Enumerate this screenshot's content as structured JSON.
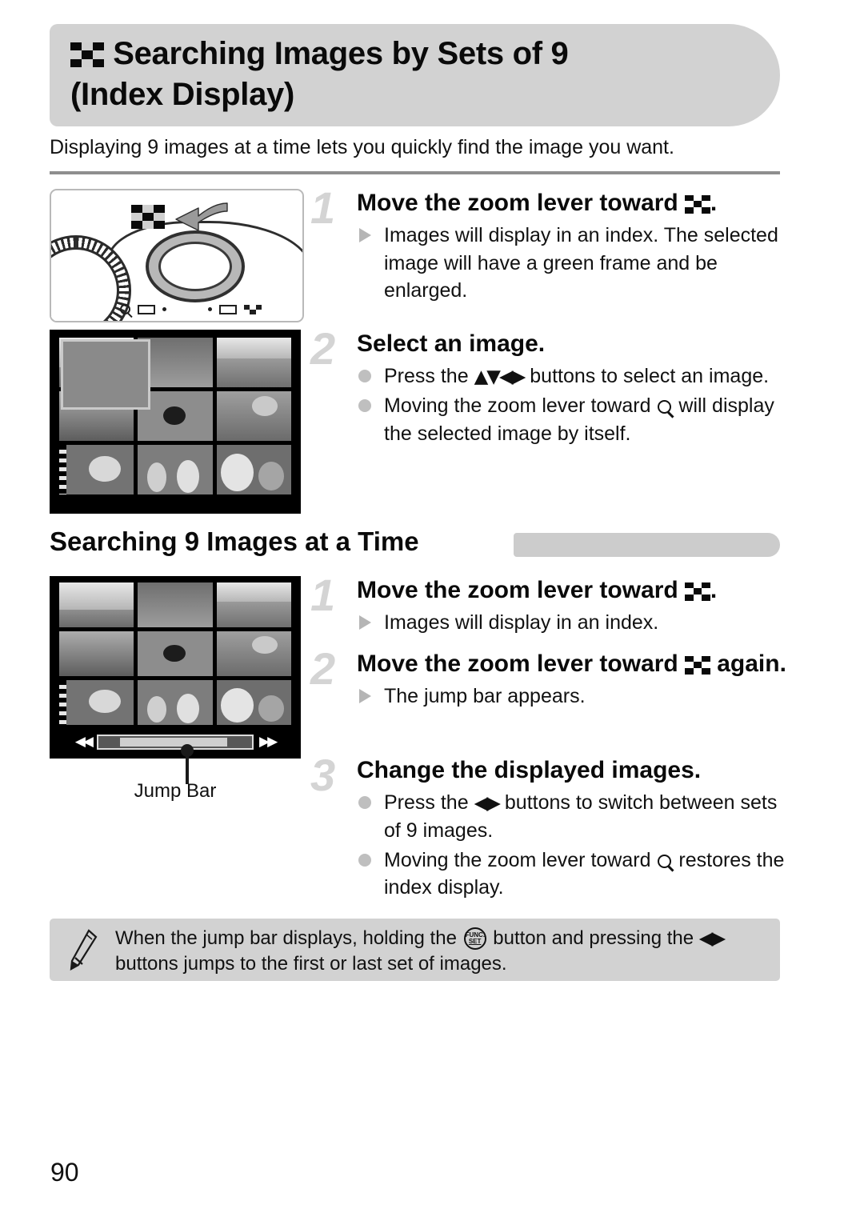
{
  "header": {
    "icon": "checkerboard-index-icon",
    "title_line1": "Searching Images by Sets of 9",
    "title_line2": "(Index Display)"
  },
  "intro": "Displaying 9 images at a time lets you quickly find the image you want.",
  "section1": {
    "steps": [
      {
        "number": "1",
        "title_before": "Move the zoom lever toward",
        "title_after": ".",
        "bullets": [
          {
            "marker": "triangle",
            "text": "Images will display in an index. The selected image will have a green frame and be enlarged."
          }
        ]
      },
      {
        "number": "2",
        "title_before": "Select an image.",
        "title_after": "",
        "bullets": [
          {
            "marker": "dot",
            "text_before": "Press the",
            "glyphs": "▲▼◀▶",
            "text_after": "buttons to select an image."
          },
          {
            "marker": "dot",
            "text_before": "Moving the zoom lever toward",
            "glyphs": "magnifier",
            "text_after": "will display the selected image by itself."
          }
        ]
      }
    ]
  },
  "section2": {
    "heading": "Searching 9 Images at a Time",
    "steps": [
      {
        "number": "1",
        "title_before": "Move the zoom lever toward",
        "title_after": ".",
        "bullets": [
          {
            "marker": "triangle",
            "text": "Images will display in an index."
          }
        ]
      },
      {
        "number": "2",
        "title_before": "Move the zoom lever toward",
        "title_after": "again.",
        "bullets": [
          {
            "marker": "triangle",
            "text": "The jump bar appears."
          }
        ]
      },
      {
        "number": "3",
        "title_before": "Change the displayed images.",
        "title_after": "",
        "bullets": [
          {
            "marker": "dot",
            "text_before": "Press the",
            "glyphs": "◀▶",
            "text_after": "buttons to switch between sets of 9 images."
          },
          {
            "marker": "dot",
            "text_before": "Moving the zoom lever toward",
            "glyphs": "magnifier",
            "text_after": "restores the index display."
          }
        ]
      }
    ]
  },
  "figures": {
    "camera_caption": "camera-top-zoom-lever-diagram",
    "jump_bar_label": "Jump Bar"
  },
  "note": {
    "icon": "pencil-icon",
    "text_before": "When the jump bar displays, holding the",
    "button_label_top": "FUNC.",
    "button_label_bottom": "SET",
    "text_middle": "button and pressing the",
    "glyphs": "◀▶",
    "text_after": "buttons jumps to the first or last set of images."
  },
  "page_number": "90",
  "colors": {
    "band_gray": "#d2d2d2",
    "rule_gray": "#8e8e8e",
    "step_number_gray": "#d4d4d4",
    "bullet_gray": "#bfbfbf",
    "screen_black": "#000000"
  }
}
